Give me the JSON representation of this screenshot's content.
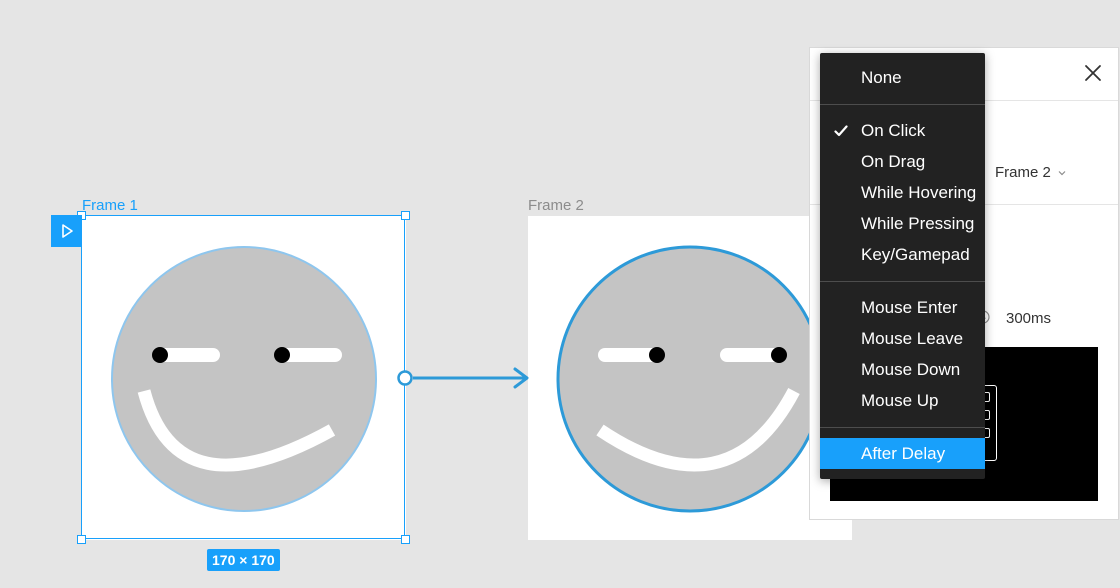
{
  "canvas": {
    "frame1_label": "Frame 1",
    "frame2_label": "Frame 2",
    "size_badge": "170 × 170"
  },
  "panel": {
    "destination": "Frame 2",
    "duration": "300ms"
  },
  "menu": {
    "items": [
      {
        "label": "None",
        "checked": false
      },
      {
        "label": "On Click",
        "checked": true
      },
      {
        "label": "On Drag",
        "checked": false
      },
      {
        "label": "While Hovering",
        "checked": false
      },
      {
        "label": "While Pressing",
        "checked": false
      },
      {
        "label": "Key/Gamepad",
        "checked": false
      },
      {
        "label": "Mouse Enter",
        "checked": false
      },
      {
        "label": "Mouse Leave",
        "checked": false
      },
      {
        "label": "Mouse Down",
        "checked": false
      },
      {
        "label": "Mouse Up",
        "checked": false
      },
      {
        "label": "After Delay",
        "checked": false,
        "highlighted": true
      }
    ]
  },
  "colors": {
    "accent": "#18a0fb",
    "canvas_bg": "#e5e5e5",
    "menu_bg": "#222222",
    "face_fill": "#c4c4c4"
  }
}
